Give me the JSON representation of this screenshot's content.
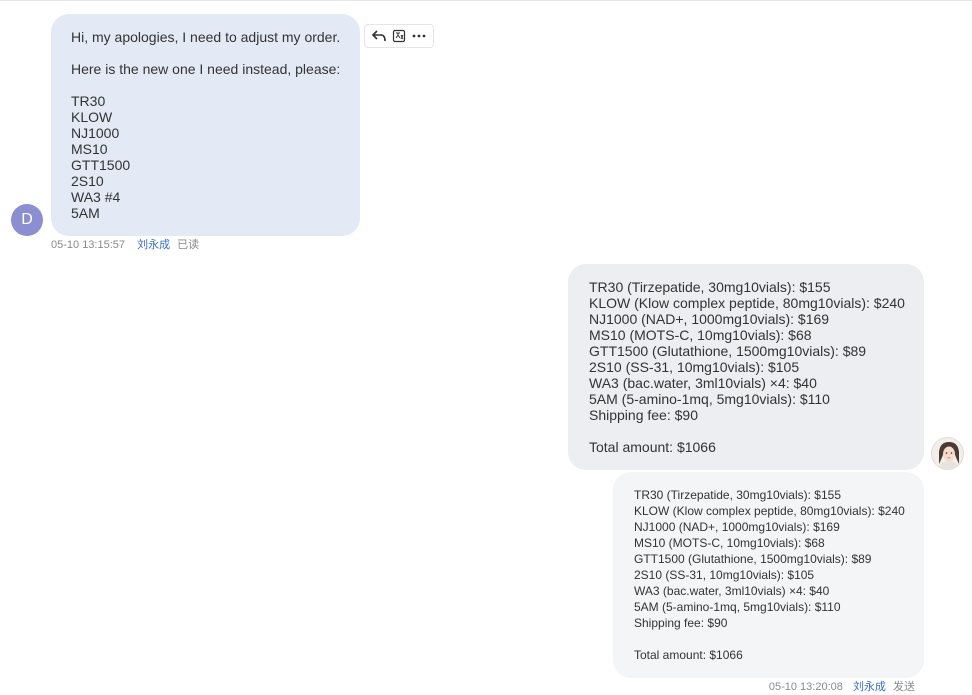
{
  "incoming": {
    "avatar_letter": "D",
    "avatar_color": "#8b8fd1",
    "lines": [
      "Hi, my apologies, I need to adjust my order.",
      "",
      "Here is the new one I need instead, please:",
      "",
      "TR30",
      "KLOW",
      "NJ1000",
      "MS10",
      "GTT1500",
      "2S10",
      "WA3 #4",
      "5AM"
    ],
    "time": "05-10 13:15:57",
    "sender": "刘永成",
    "status": "已读"
  },
  "tools": {
    "reply_icon": "reply-icon",
    "translate_icon": "translate-icon",
    "more_icon": "more-icon"
  },
  "outgoing": {
    "lines": [
      "TR30 (Tirzepatide, 30mg10vials): $155",
      "KLOW (Klow complex peptide, 80mg10vials): $240",
      "NJ1000 (NAD+, 1000mg10vials): $169",
      "MS10 (MOTS-C, 10mg10vials): $68",
      "GTT1500 (Glutathione, 1500mg10vials): $89",
      "2S10 (SS-31, 10mg10vials): $105",
      "WA3 (bac.water, 3ml10vials) ×4: $40",
      "5AM (5-amino-1mq, 5mg10vials): $110",
      "Shipping fee: $90",
      "",
      "Total amount: $1066"
    ],
    "time": "05-10 13:20:08",
    "sender": "刘永成",
    "status": "发送"
  },
  "colors": {
    "incoming_bubble": "#e4e9f6",
    "outgoing_bubble": "#eceef1",
    "quoted_bubble": "#f4f5f7",
    "link": "#3a6fc4"
  }
}
